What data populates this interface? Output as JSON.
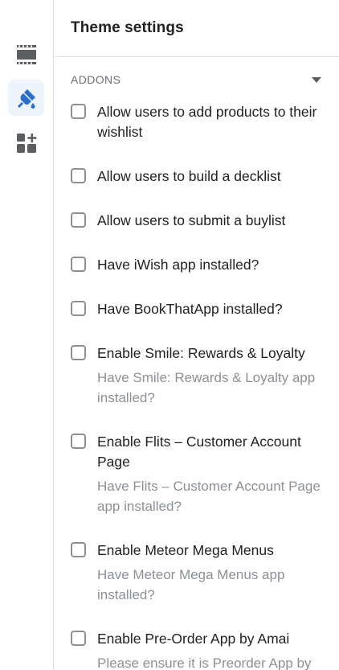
{
  "panel": {
    "title": "Theme settings"
  },
  "section": {
    "title": "ADDONS"
  },
  "rail": {
    "items": [
      {
        "icon": "sections-layout-icon"
      },
      {
        "icon": "theme-brush-icon",
        "active": true
      },
      {
        "icon": "app-blocks-add-icon"
      }
    ]
  },
  "settings": [
    {
      "label": "Allow users to add products to their wishlist",
      "help": ""
    },
    {
      "label": "Allow users to build a decklist",
      "help": ""
    },
    {
      "label": "Allow users to submit a buylist",
      "help": ""
    },
    {
      "label": "Have iWish app installed?",
      "help": ""
    },
    {
      "label": "Have BookThatApp installed?",
      "help": ""
    },
    {
      "label": "Enable Smile: Rewards & Loyalty",
      "help": "Have Smile: Rewards & Loyalty app installed?"
    },
    {
      "label": "Enable Flits – Customer Account Page",
      "help": "Have Flits – Customer Account Page app installed?"
    },
    {
      "label": "Enable Meteor Mega Menus",
      "help": "Have Meteor Mega Menus app installed?"
    },
    {
      "label": "Enable Pre-Order App by Amai",
      "help": "Please ensure it is Preorder App by"
    }
  ],
  "colors": {
    "accent": "#2c6ecb",
    "text": "#202223",
    "subdued": "#8c9196",
    "border": "#e1e3e5"
  }
}
